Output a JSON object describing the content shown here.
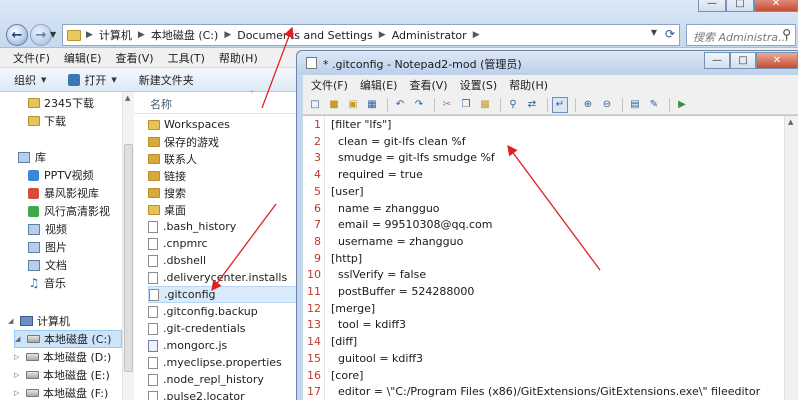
{
  "explorer": {
    "breadcrumb": [
      "计算机",
      "本地磁盘 (C:)",
      "Documents and Settings",
      "Administrator"
    ],
    "search_placeholder": "搜索 Administra...",
    "menu": [
      "文件(F)",
      "编辑(E)",
      "查看(V)",
      "工具(T)",
      "帮助(H)"
    ],
    "toolbar": {
      "organize": "组织",
      "open": "打开",
      "new_folder": "新建文件夹"
    },
    "nav_items": [
      {
        "label": "2345下载",
        "icon": "folder-icon"
      },
      {
        "label": "下载",
        "icon": "folder-icon"
      },
      {
        "label": "库",
        "icon": "library-icon"
      },
      {
        "label": "PPTV视频",
        "icon": "pptv-icon"
      },
      {
        "label": "暴风影视库",
        "icon": "baofeng-icon"
      },
      {
        "label": "风行高清影视",
        "icon": "funshion-icon"
      },
      {
        "label": "视频",
        "icon": "video-library-icon"
      },
      {
        "label": "图片",
        "icon": "picture-library-icon"
      },
      {
        "label": "文档",
        "icon": "document-library-icon"
      },
      {
        "label": "音乐",
        "icon": "music-icon"
      },
      {
        "label": "计算机",
        "icon": "computer-icon"
      },
      {
        "label": "本地磁盘 (C:)",
        "icon": "drive-icon"
      },
      {
        "label": "本地磁盘 (D:)",
        "icon": "drive-icon"
      },
      {
        "label": "本地磁盘 (E:)",
        "icon": "drive-icon"
      },
      {
        "label": "本地磁盘 (F:)",
        "icon": "drive-icon"
      }
    ],
    "column_header": "名称",
    "files": [
      {
        "name": "Workspaces",
        "type": "folder"
      },
      {
        "name": "保存的游戏",
        "type": "folder"
      },
      {
        "name": "联系人",
        "type": "folder"
      },
      {
        "name": "链接",
        "type": "folder"
      },
      {
        "name": "搜索",
        "type": "folder"
      },
      {
        "name": "桌面",
        "type": "folder"
      },
      {
        "name": ".bash_history",
        "type": "file"
      },
      {
        "name": ".cnpmrc",
        "type": "file"
      },
      {
        "name": ".dbshell",
        "type": "file"
      },
      {
        "name": ".deliverycenter.installs",
        "type": "file"
      },
      {
        "name": ".gitconfig",
        "type": "file"
      },
      {
        "name": ".gitconfig.backup",
        "type": "file"
      },
      {
        "name": ".git-credentials",
        "type": "file"
      },
      {
        "name": ".mongorc.js",
        "type": "js"
      },
      {
        "name": ".myeclipse.properties",
        "type": "file"
      },
      {
        "name": ".node_repl_history",
        "type": "file"
      },
      {
        "name": ".pulse2.locator",
        "type": "file"
      }
    ]
  },
  "notepad": {
    "title": "* .gitconfig - Notepad2-mod (管理员)",
    "menu": [
      "文件(F)",
      "编辑(E)",
      "查看(V)",
      "设置(S)",
      "帮助(H)"
    ],
    "lines": [
      {
        "n": "1",
        "text": "[filter \"lfs\"]"
      },
      {
        "n": "2",
        "text": "  clean = git-lfs clean %f"
      },
      {
        "n": "3",
        "text": "  smudge = git-lfs smudge %f"
      },
      {
        "n": "4",
        "text": "  required = true"
      },
      {
        "n": "5",
        "text": "[user]"
      },
      {
        "n": "6",
        "text": "  name = zhangguo"
      },
      {
        "n": "7",
        "text": "  email = 99510308@qq.com"
      },
      {
        "n": "8",
        "text": "  username = zhangguo"
      },
      {
        "n": "9",
        "text": "[http]"
      },
      {
        "n": "10",
        "text": "  sslVerify = false"
      },
      {
        "n": "11",
        "text": "  postBuffer = 524288000"
      },
      {
        "n": "12",
        "text": "[merge]"
      },
      {
        "n": "13",
        "text": "  tool = kdiff3"
      },
      {
        "n": "14",
        "text": "[diff]"
      },
      {
        "n": "15",
        "text": "  guitool = kdiff3"
      },
      {
        "n": "16",
        "text": "[core]"
      },
      {
        "n": "17",
        "text": "  editor = \\\"C:/Program Files (x86)/GitExtensions/GitExtensions.exe\\\" fileeditor"
      }
    ]
  },
  "colors": {
    "annotation_arrow": "#e02020",
    "line_number": "#c0392b"
  }
}
